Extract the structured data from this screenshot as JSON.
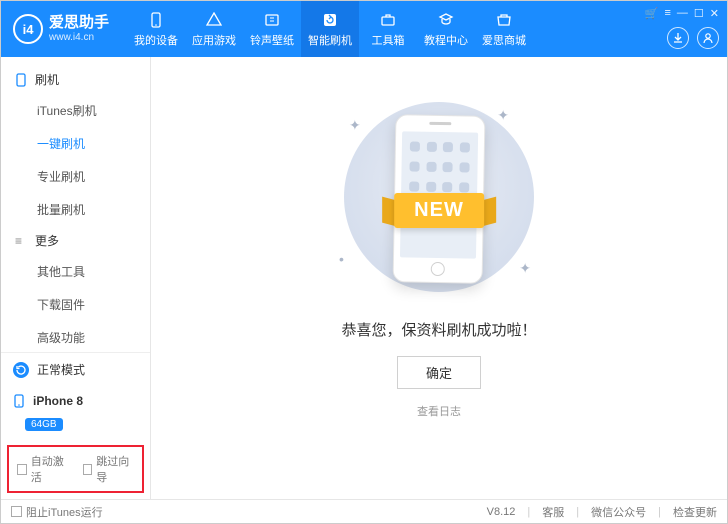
{
  "brand": {
    "name": "爱思助手",
    "site": "www.i4.cn",
    "badge": "i4"
  },
  "window_controls": [
    "cart-icon",
    "menu-icon",
    "minimize-icon",
    "maximize-icon",
    "close-icon"
  ],
  "nav": [
    {
      "label": "我的设备",
      "icon": "device-icon"
    },
    {
      "label": "应用游戏",
      "icon": "apps-icon"
    },
    {
      "label": "铃声壁纸",
      "icon": "ringtone-icon"
    },
    {
      "label": "智能刷机",
      "icon": "flash-icon",
      "active": true
    },
    {
      "label": "工具箱",
      "icon": "toolbox-icon"
    },
    {
      "label": "教程中心",
      "icon": "tutorial-icon"
    },
    {
      "label": "爱思商城",
      "icon": "store-icon"
    }
  ],
  "header_actions": [
    "download-icon",
    "user-icon"
  ],
  "sidebar": {
    "groups": [
      {
        "title": "刷机",
        "icon": "phone-icon",
        "items": [
          "iTunes刷机",
          "一键刷机",
          "专业刷机",
          "批量刷机"
        ],
        "active_index": 1
      },
      {
        "title": "更多",
        "icon": "more-icon",
        "items": [
          "其他工具",
          "下载固件",
          "高级功能"
        ],
        "active_index": -1
      }
    ],
    "mode": "正常模式",
    "device": {
      "name": "iPhone 8",
      "storage": "64GB"
    },
    "checks": [
      "自动激活",
      "跳过向导"
    ]
  },
  "main": {
    "ribbon": "NEW",
    "success_text": "恭喜您，保资料刷机成功啦！",
    "ok": "确定",
    "log": "查看日志"
  },
  "footer": {
    "block_itunes": "阻止iTunes运行",
    "version": "V8.12",
    "links": [
      "客服",
      "微信公众号",
      "检查更新"
    ]
  }
}
